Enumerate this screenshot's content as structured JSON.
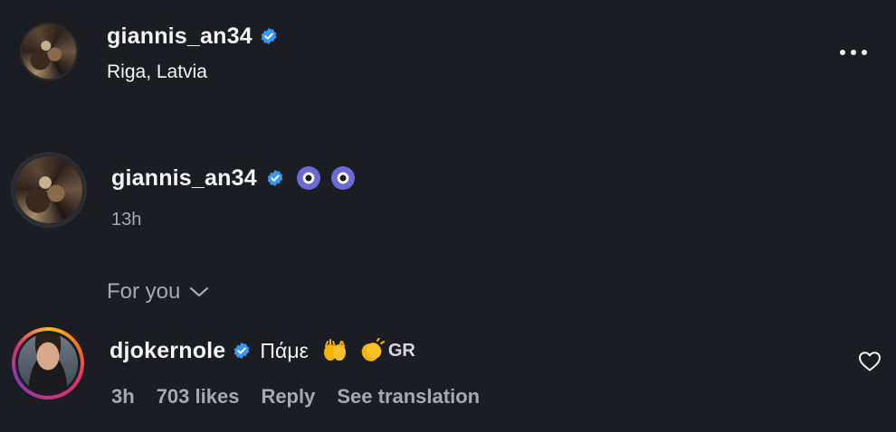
{
  "post_header": {
    "username": "giannis_an34",
    "location": "Riga, Latvia",
    "more_icon": "more-horizontal-icon"
  },
  "caption": {
    "username": "giannis_an34",
    "emojis": [
      "evil-eye-emoji",
      "evil-eye-emoji"
    ],
    "time": "13h"
  },
  "for_you": {
    "label": "For you",
    "icon": "chevron-down-icon"
  },
  "comment": {
    "username": "djokernole",
    "text": "Πάμε",
    "flag": "GR",
    "time": "3h",
    "likes": "703 likes",
    "reply": "Reply",
    "translate": "See translation",
    "like_icon": "heart-icon"
  },
  "colors": {
    "background": "#1c1d22",
    "verified": "#3897f0",
    "muted": "#a8a8b0",
    "text": "#f5f5f5"
  }
}
